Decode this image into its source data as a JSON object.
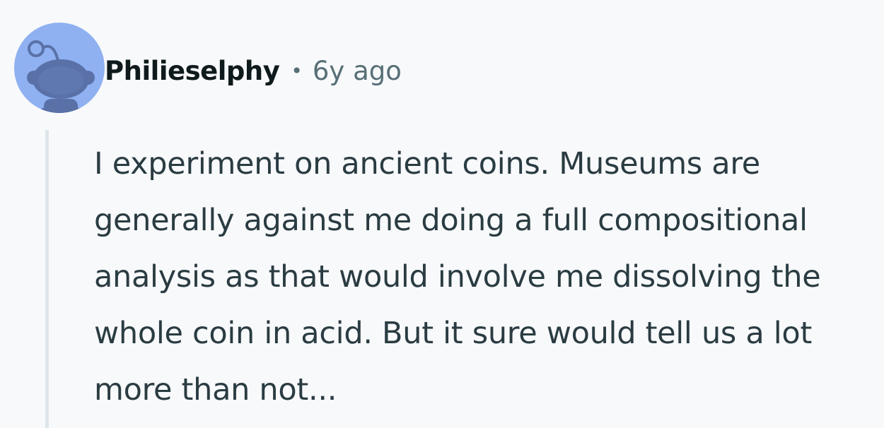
{
  "comment": {
    "author": "Philieselphy",
    "separator": "•",
    "age": "6y ago",
    "avatar_icon": "reddit-snoo-icon",
    "body": "I experiment on ancient coins. Museums are generally against me doing a full compositional analysis as that would involve me dissolving the whole coin in acid. But it sure would tell us a lot more than not..."
  },
  "colors": {
    "background": "#f8f9fb",
    "avatar_bg": "#8fb1f1",
    "avatar_snoo": "#5a71a8",
    "username": "#0f1a1c",
    "meta": "#576f76",
    "body_text": "#2a3c42",
    "thread_line": "#dfe6ea"
  }
}
